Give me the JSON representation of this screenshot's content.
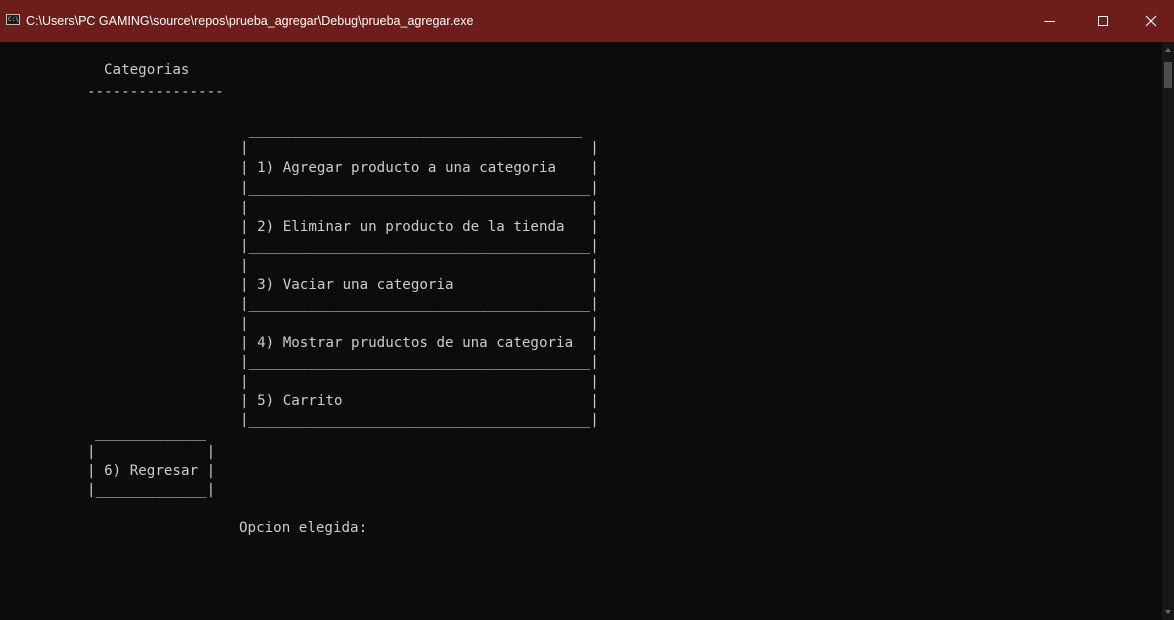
{
  "window": {
    "title": "C:\\Users\\PC GAMING\\source\\repos\\prueba_agregar\\Debug\\prueba_agregar.exe",
    "icon_text": "C:\\",
    "minimize_glyph": "",
    "close_glyph": "✕"
  },
  "console": {
    "heading": "Categorias",
    "heading_rule": "----------------",
    "menu": {
      "top_border": "_______________________________________",
      "options": [
        {
          "blank": "|                                        |",
          "label": "| 1) Agregar producto a una categoria    |",
          "bottom": "|________________________________________|"
        },
        {
          "blank": "|                                        |",
          "label": "| 2) Eliminar un producto de la tienda   |",
          "bottom": "|________________________________________|"
        },
        {
          "blank": "|                                        |",
          "label": "| 3) Vaciar una categoria                |",
          "bottom": "|________________________________________|"
        },
        {
          "blank": "|                                        |",
          "label": "| 4) Mostrar pruductos de una categoria  |",
          "bottom": "|________________________________________|"
        },
        {
          "blank": "|                                        |",
          "label": "| 5) Carrito                             |",
          "bottom": "|________________________________________|"
        }
      ]
    },
    "back": {
      "top_border": "_____________",
      "blank": "|             |",
      "label": "| 6) Regresar |",
      "bottom": "|_____________|"
    },
    "prompt": "Opcion elegida: "
  },
  "colors": {
    "titlebar": "#6d1e1b",
    "console_bg": "#0c0c0c",
    "console_text": "#cccccc"
  },
  "icons": [
    "console-app-icon",
    "minimize-icon",
    "maximize-icon",
    "close-icon",
    "scroll-up-icon",
    "scroll-down-icon"
  ]
}
